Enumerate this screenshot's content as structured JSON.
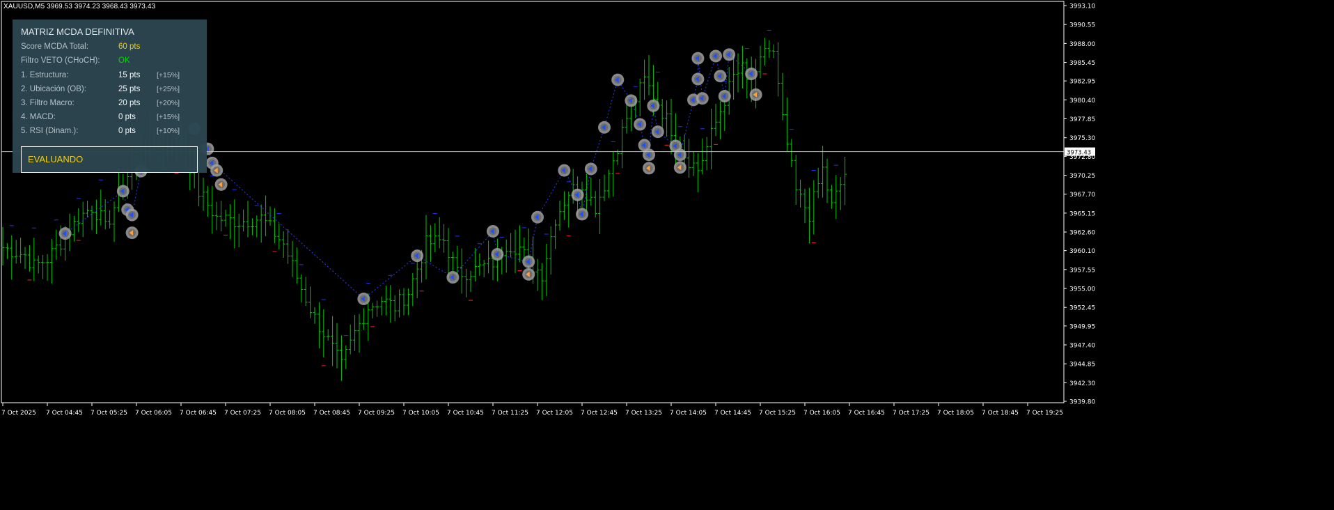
{
  "header": {
    "symbol": "XAUUSD,M5",
    "ohlc": "3969.53 3974.23 3968.43 3973.43"
  },
  "panel": {
    "title": "MATRIZ MCDA DEFINITIVA",
    "score_label": "Score MCDA Total:",
    "score_value": "60 pts",
    "veto_label": "Filtro VETO (CHoCH):",
    "veto_value": "OK",
    "rows": [
      {
        "label": "1. Estructura:",
        "value": "15 pts",
        "weight": "[+15%]"
      },
      {
        "label": "2. Ubicación (OB):",
        "value": "25 pts",
        "weight": "[+25%]"
      },
      {
        "label": "3. Filtro Macro:",
        "value": "20 pts",
        "weight": "[+20%]"
      },
      {
        "label": "4. MACD:",
        "value": "0 pts",
        "weight": "[+15%]"
      },
      {
        "label": "5. RSI (Dinam.):",
        "value": "0 pts",
        "weight": "[+10%]"
      }
    ],
    "status": "EVALUANDO",
    "colors": {
      "score": "#ffd700",
      "veto_ok": "#00e000",
      "status": "#ffd700",
      "background": "#2c4650"
    }
  },
  "chart_data": {
    "type": "bar",
    "style": "ohlc-bars",
    "symbol": "XAUUSD",
    "timeframe": "M5",
    "current_price": 3973.43,
    "current_price_label": "3973.43",
    "ylim": [
      3939.8,
      3993.1
    ],
    "y_ticks": [
      "3993.10",
      "3990.55",
      "3988.00",
      "3985.45",
      "3982.95",
      "3980.40",
      "3977.85",
      "3975.30",
      "3972.80",
      "3970.25",
      "3967.70",
      "3965.15",
      "3962.60",
      "3960.10",
      "3957.55",
      "3955.00",
      "3952.45",
      "3949.95",
      "3947.40",
      "3944.85",
      "3942.30",
      "3939.80"
    ],
    "x_ticks": [
      "7 Oct 2025",
      "7 Oct 04:45",
      "7 Oct 05:25",
      "7 Oct 06:05",
      "7 Oct 06:45",
      "7 Oct 07:25",
      "7 Oct 08:05",
      "7 Oct 08:45",
      "7 Oct 09:25",
      "7 Oct 10:05",
      "7 Oct 10:45",
      "7 Oct 11:25",
      "7 Oct 12:05",
      "7 Oct 12:45",
      "7 Oct 13:25",
      "7 Oct 14:05",
      "7 Oct 14:45",
      "7 Oct 15:25",
      "7 Oct 16:05",
      "7 Oct 16:45",
      "7 Oct 17:25",
      "7 Oct 18:05",
      "7 Oct 18:45",
      "7 Oct 19:25"
    ],
    "bar_anchors": [
      [
        0,
        3960.5
      ],
      [
        5,
        3959.5
      ],
      [
        7,
        3958.0
      ],
      [
        10,
        3959.0
      ],
      [
        14,
        3962.0
      ],
      [
        17,
        3964.5
      ],
      [
        20,
        3966.0
      ],
      [
        22,
        3964.5
      ],
      [
        23,
        3963.0
      ],
      [
        26,
        3967.5
      ],
      [
        30,
        3973.0
      ],
      [
        33,
        3975.0
      ],
      [
        37,
        3974.0
      ],
      [
        40,
        3975.5
      ],
      [
        42,
        3971.5
      ],
      [
        44,
        3968.0
      ],
      [
        48,
        3964.5
      ],
      [
        53,
        3964.0
      ],
      [
        58,
        3964.5
      ],
      [
        63,
        3961.0
      ],
      [
        67,
        3955.0
      ],
      [
        70,
        3951.0
      ],
      [
        73,
        3948.0
      ],
      [
        76,
        3944.5
      ],
      [
        79,
        3949.0
      ],
      [
        82,
        3952.5
      ],
      [
        85,
        3953.5
      ],
      [
        88,
        3952.5
      ],
      [
        91,
        3954.5
      ],
      [
        95,
        3961.0
      ],
      [
        99,
        3961.5
      ],
      [
        102,
        3957.0
      ],
      [
        106,
        3957.5
      ],
      [
        110,
        3958.5
      ],
      [
        113,
        3961.0
      ],
      [
        116,
        3960.5
      ],
      [
        118,
        3958.5
      ],
      [
        121,
        3957.0
      ],
      [
        124,
        3964.5
      ],
      [
        127,
        3968.0
      ],
      [
        130,
        3969.0
      ],
      [
        133,
        3966.0
      ],
      [
        136,
        3970.5
      ],
      [
        140,
        3978.0
      ],
      [
        144,
        3983.0
      ],
      [
        147,
        3980.0
      ],
      [
        150,
        3976.5
      ],
      [
        153,
        3973.0
      ],
      [
        156,
        3971.0
      ],
      [
        158,
        3974.0
      ],
      [
        161,
        3979.0
      ],
      [
        164,
        3983.5
      ],
      [
        166,
        3984.5
      ],
      [
        168,
        3981.0
      ],
      [
        171,
        3987.5
      ],
      [
        173,
        3986.5
      ],
      [
        175,
        3977.5
      ],
      [
        178,
        3968.0
      ],
      [
        181,
        3965.0
      ],
      [
        184,
        3971.0
      ],
      [
        186,
        3966.0
      ],
      [
        189,
        3970.5
      ]
    ],
    "markers": [
      {
        "i": 14,
        "price": 3962.4,
        "dir": "up"
      },
      {
        "i": 27,
        "price": 3968.1,
        "dir": "up"
      },
      {
        "i": 28,
        "price": 3965.6,
        "dir": "up"
      },
      {
        "i": 29,
        "price": 3964.9,
        "dir": "up"
      },
      {
        "i": 29,
        "price": 3962.5,
        "dir": "down"
      },
      {
        "i": 31,
        "price": 3970.8,
        "dir": "up"
      },
      {
        "i": 43,
        "price": 3976.5,
        "dir": "up"
      },
      {
        "i": 46,
        "price": 3973.8,
        "dir": "up"
      },
      {
        "i": 47,
        "price": 3971.9,
        "dir": "up"
      },
      {
        "i": 48,
        "price": 3970.9,
        "dir": "down"
      },
      {
        "i": 49,
        "price": 3969.0,
        "dir": "down"
      },
      {
        "i": 81,
        "price": 3953.6,
        "dir": "up"
      },
      {
        "i": 93,
        "price": 3959.4,
        "dir": "up"
      },
      {
        "i": 101,
        "price": 3956.5,
        "dir": "up"
      },
      {
        "i": 110,
        "price": 3962.7,
        "dir": "up"
      },
      {
        "i": 111,
        "price": 3959.6,
        "dir": "up"
      },
      {
        "i": 118,
        "price": 3958.6,
        "dir": "up"
      },
      {
        "i": 118,
        "price": 3956.9,
        "dir": "down"
      },
      {
        "i": 120,
        "price": 3964.6,
        "dir": "up"
      },
      {
        "i": 126,
        "price": 3970.9,
        "dir": "up"
      },
      {
        "i": 129,
        "price": 3967.6,
        "dir": "up"
      },
      {
        "i": 130,
        "price": 3965.0,
        "dir": "up"
      },
      {
        "i": 132,
        "price": 3971.1,
        "dir": "up"
      },
      {
        "i": 135,
        "price": 3976.7,
        "dir": "up"
      },
      {
        "i": 138,
        "price": 3983.1,
        "dir": "up"
      },
      {
        "i": 141,
        "price": 3980.3,
        "dir": "up"
      },
      {
        "i": 143,
        "price": 3977.1,
        "dir": "up"
      },
      {
        "i": 144,
        "price": 3974.3,
        "dir": "up"
      },
      {
        "i": 145,
        "price": 3973.0,
        "dir": "up"
      },
      {
        "i": 145,
        "price": 3971.2,
        "dir": "down"
      },
      {
        "i": 146,
        "price": 3979.6,
        "dir": "up"
      },
      {
        "i": 147,
        "price": 3976.1,
        "dir": "up"
      },
      {
        "i": 151,
        "price": 3974.2,
        "dir": "up"
      },
      {
        "i": 152,
        "price": 3973.0,
        "dir": "up"
      },
      {
        "i": 152,
        "price": 3971.3,
        "dir": "down"
      },
      {
        "i": 155,
        "price": 3980.4,
        "dir": "up"
      },
      {
        "i": 156,
        "price": 3983.2,
        "dir": "up"
      },
      {
        "i": 156,
        "price": 3986.0,
        "dir": "up"
      },
      {
        "i": 157,
        "price": 3980.6,
        "dir": "up"
      },
      {
        "i": 160,
        "price": 3986.3,
        "dir": "up"
      },
      {
        "i": 161,
        "price": 3983.6,
        "dir": "up"
      },
      {
        "i": 162,
        "price": 3980.9,
        "dir": "up"
      },
      {
        "i": 163,
        "price": 3986.5,
        "dir": "up"
      },
      {
        "i": 168,
        "price": 3983.9,
        "dir": "up"
      },
      {
        "i": 169,
        "price": 3981.1,
        "dir": "down"
      }
    ],
    "colors": {
      "bars": "#00c800",
      "grid": "#ffffff",
      "price_line": "#c0c0c0",
      "marker_ring": "#a0a0a0",
      "marker_up": "#1f4fff",
      "marker_down": "#ff9f3f",
      "blue_ticks": "#2233ff",
      "red_ticks": "#ff2020"
    },
    "grid": false
  }
}
